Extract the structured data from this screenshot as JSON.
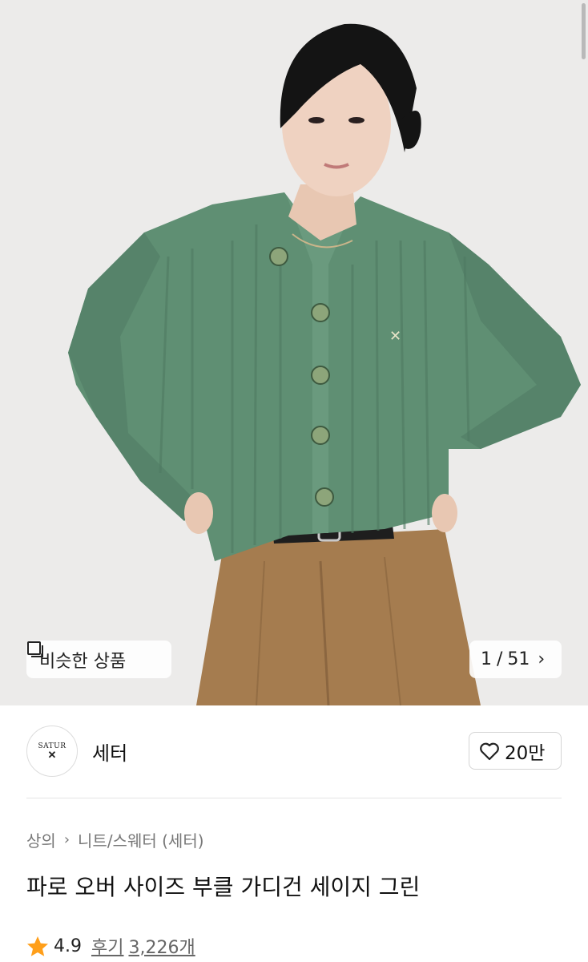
{
  "gallery": {
    "similar_label": "비슷한 상품",
    "current": "1",
    "total": "51",
    "separator": "/"
  },
  "brand": {
    "logo_text_top": "SATUR",
    "logo_mark": "✕",
    "name": "세터"
  },
  "like": {
    "count": "20만"
  },
  "breadcrumb": [
    "상의",
    "니트/스웨터 (세터)"
  ],
  "product": {
    "title": "파로 오버 사이즈 부클 가디건 세이지 그린"
  },
  "rating": {
    "score": "4.9",
    "review_label": "후기",
    "review_count": "3,226개"
  },
  "colors": {
    "cardigan": "#5f8f73",
    "pants": "#a57c4f",
    "star": "#ff9f1a"
  },
  "icons": {
    "similar": "square-stack-icon",
    "next": "chevron-right-icon",
    "like": "heart-icon",
    "rating": "star-icon",
    "crumb_sep": "chevron-right-icon"
  }
}
